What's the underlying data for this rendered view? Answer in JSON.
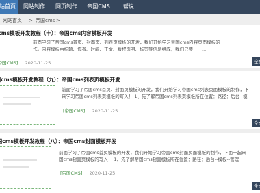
{
  "nav": {
    "items": [
      {
        "label": "网站首页",
        "active": true
      },
      {
        "label": "网站制作",
        "active": false
      },
      {
        "label": "网页制作",
        "active": false
      },
      {
        "label": "帝国CMS",
        "active": false
      },
      {
        "label": "帮说",
        "active": false
      }
    ]
  },
  "breadcrumb": {
    "home": "网站首页",
    "sep1": ">",
    "current": "帝国cms",
    "sep2": ">"
  },
  "articles": [
    {
      "title": "帝国cms模板开发教程（十）：帝国cms内容模板开发",
      "excerpt": [
        "前面学习了帝国cms首页、封面页、列表页模板的开发，我们开始学习帝国cms内容页面模板的",
        "作。内容模板由标题、作者、时间、正文、版权声明、标签等信息组成，我们只要一一..."
      ],
      "category": "[帝国CMS]",
      "date": "2020-11-25",
      "more": "全文"
    },
    {
      "title": "帝国cms模板开发教程（九）：帝国cms列表页模板开发",
      "excerpt": [
        "前面学习了帝国cms首页、封面页模板的开发，我们开始学习帝国cms列表页面模板的制作，下",
        "来学习帝国cms列表页模板的写入！ 1、先了解帝国cms列表页模板所在位置：路径：后台--模"
      ],
      "category": "[帝国CMS]",
      "date": "2020-11-25",
      "more": "全文"
    },
    {
      "title": "帝国cms模板开发教程（八）：帝国cms封面模板开发",
      "excerpt": [
        "前面学习了帝国cms首页模板的开发，我们开始学习帝国cms封面页面模板的制作，下面一起来",
        "国cms封面页模板的写入！ 1、先了解帝国cms封面模板所在位置：路径：后台--模板--管理"
      ],
      "category": "[帝国CMS]",
      "date": "2020-11-25",
      "more": "全文"
    }
  ]
}
